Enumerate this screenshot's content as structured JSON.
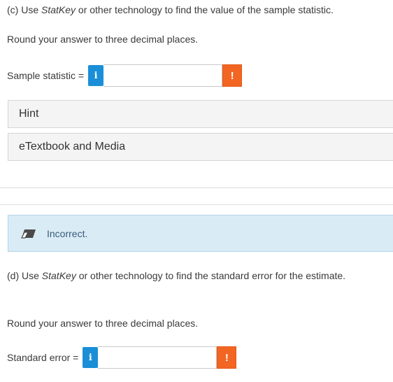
{
  "part_c": {
    "prefix": "(c) Use ",
    "tool_name": "StatKey",
    "suffix": " or other technology to find the value of the sample statistic.",
    "rounding": "Round your answer to three decimal places.",
    "field_label": "Sample statistic =",
    "input_value": "",
    "info_glyph": "i",
    "warn_glyph": "!"
  },
  "help": {
    "hint_label": "Hint",
    "etextbook_label": "eTextbook and Media"
  },
  "feedback": {
    "icon": "eraser-icon",
    "text": "Incorrect."
  },
  "part_d": {
    "prefix": "(d) Use ",
    "tool_name": "StatKey",
    "suffix": " or other technology to find the standard error for the estimate.",
    "rounding": "Round your answer to three decimal places.",
    "field_label": "Standard error =",
    "input_value": "",
    "info_glyph": "i",
    "warn_glyph": "!"
  },
  "colors": {
    "info_button": "#1a8fd8",
    "warn_button": "#f26522",
    "feedback_bg": "#d9ecf6",
    "feedback_text": "#3a5a78"
  }
}
